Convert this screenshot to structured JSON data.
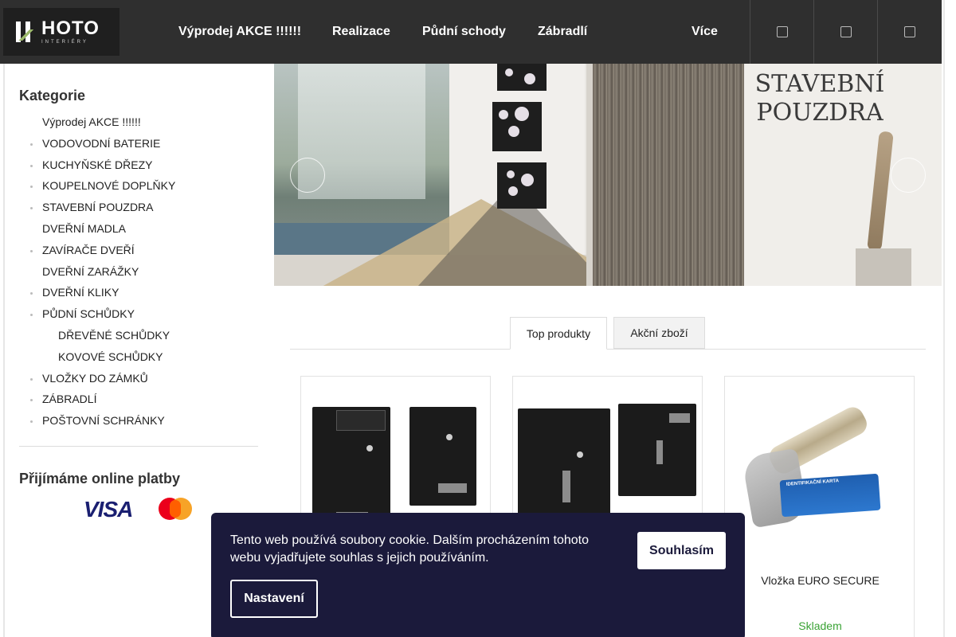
{
  "brand": {
    "logo_text": "HOTO",
    "logo_subtext": "INTERIÉRY"
  },
  "nav": {
    "items": [
      {
        "label": "Výprodej AKCE !!!!!!"
      },
      {
        "label": "Realizace"
      },
      {
        "label": "Půdní schody"
      },
      {
        "label": "Zábradlí"
      }
    ],
    "more_label": "Více",
    "more_caret": "",
    "icons": [
      "search-icon",
      "user-icon",
      "cart-icon"
    ]
  },
  "sidebar": {
    "categories_title": "Kategorie",
    "categories": [
      {
        "label": "Výprodej AKCE !!!!!!",
        "bullet": false,
        "level": 0
      },
      {
        "label": "VODOVODNÍ BATERIE",
        "bullet": true,
        "level": 0
      },
      {
        "label": "KUCHYŇSKÉ DŘEZY",
        "bullet": true,
        "level": 0
      },
      {
        "label": "KOUPELNOVÉ DOPLŇKY",
        "bullet": true,
        "level": 0
      },
      {
        "label": "STAVEBNÍ POUZDRA",
        "bullet": true,
        "level": 0
      },
      {
        "label": "DVEŘNÍ MADLA",
        "bullet": false,
        "level": 0
      },
      {
        "label": "ZAVÍRAČE DVEŘÍ",
        "bullet": true,
        "level": 0
      },
      {
        "label": "DVEŘNÍ ZARÁŽKY",
        "bullet": false,
        "level": 0
      },
      {
        "label": "DVEŘNÍ KLIKY",
        "bullet": true,
        "level": 0
      },
      {
        "label": "PŮDNÍ SCHŮDKY",
        "bullet": true,
        "level": 0
      },
      {
        "label": "DŘEVĚNÉ SCHŮDKY",
        "bullet": false,
        "level": 1
      },
      {
        "label": "KOVOVÉ SCHŮDKY",
        "bullet": false,
        "level": 1
      },
      {
        "label": "VLOŽKY DO ZÁMKŮ",
        "bullet": true,
        "level": 0
      },
      {
        "label": "ZÁBRADLÍ",
        "bullet": true,
        "level": 0
      },
      {
        "label": "POŠTOVNÍ SCHRÁNKY",
        "bullet": true,
        "level": 0
      }
    ],
    "payments_title": "Přijímáme online platby",
    "payment_logos": {
      "visa": "VISA",
      "mastercard": "mastercard-logo"
    }
  },
  "banner": {
    "title_line1": "STAVEBNÍ",
    "title_line2": "POUZDRA",
    "prev_icon": "",
    "next_icon": ""
  },
  "tabs": {
    "items": [
      {
        "label": "Top produkty",
        "active": true
      },
      {
        "label": "Akční zboží",
        "active": false
      }
    ]
  },
  "products": [
    {
      "name": "",
      "stock": "",
      "image": "mailbox-pair-black"
    },
    {
      "name": "",
      "stock": "",
      "image": "mailbox-pair-black-2"
    },
    {
      "name": "Vložka EURO SECURE",
      "stock": "Skladem",
      "image": "lock-cylinder",
      "card_text": "IDENTIFIKAČNÍ KARTA"
    }
  ],
  "cookie": {
    "text": "Tento web používá soubory cookie. Dalším procházením tohoto webu vyjadřujete souhlas s jejich používáním.",
    "accept_label": "Souhlasím",
    "settings_label": "Nastavení"
  },
  "colors": {
    "header_bg": "#2f2f2f",
    "cookie_bg": "#1b1a3b",
    "stock_green": "#3aa335",
    "visa_blue": "#1a1f71"
  }
}
